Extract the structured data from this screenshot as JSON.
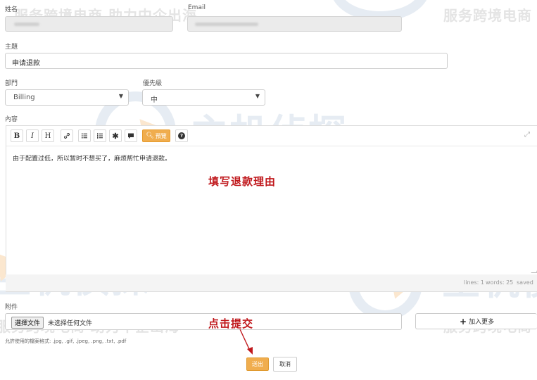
{
  "form": {
    "name_label": "姓名",
    "email_label": "Email",
    "subject_label": "主題",
    "subject_value": "申请退款",
    "department_label": "部門",
    "department_value": "Billing",
    "priority_label": "優先級",
    "priority_value": "中",
    "content_label": "內容",
    "attachments_label": "附件",
    "file_button": "選擇文件",
    "file_status": "未选择任何文件",
    "add_more": "加入更多",
    "allowed_types": "允許使用的檔案格式: .jpg, .gif, .jpeg, .png, .txt, .pdf",
    "submit_label": "送出",
    "cancel_label": "取消"
  },
  "editor": {
    "toolbar": {
      "bold": "B",
      "italic": "I",
      "heading": "H",
      "preview": "預覽"
    },
    "content": "由于配置过低，所以暂时不想买了，麻烦帮忙申请退款。",
    "status": {
      "lines": "lines: 1",
      "words": "words: 25",
      "saved": "saved"
    }
  },
  "annotations": {
    "fill_reason": "填写退款理由",
    "click_submit": "点击提交"
  },
  "watermarks": {
    "slogan_1": "服务跨境电商  助力中企出海",
    "slogan_2": "服务跨境电商",
    "slogan_3": "服务跨境电商  助力中企出海",
    "slogan_4": "服务跨境电商",
    "brand": "主机侦探"
  },
  "colors": {
    "accent": "#f0ad4e",
    "annotation": "#c0181c"
  }
}
